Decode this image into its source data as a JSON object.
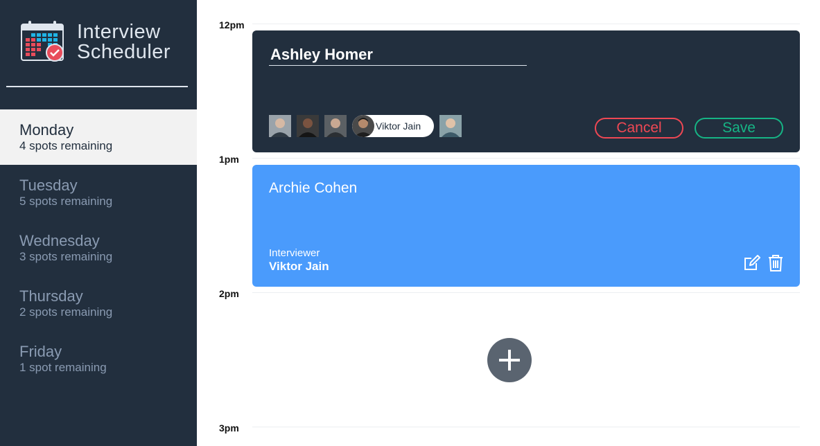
{
  "app": {
    "title_line1": "Interview",
    "title_line2": "Scheduler"
  },
  "sidebar": {
    "days": [
      {
        "name": "Monday",
        "spots": "4 spots remaining",
        "selected": true
      },
      {
        "name": "Tuesday",
        "spots": "5 spots remaining",
        "selected": false
      },
      {
        "name": "Wednesday",
        "spots": "3 spots remaining",
        "selected": false
      },
      {
        "name": "Thursday",
        "spots": "2 spots remaining",
        "selected": false
      },
      {
        "name": "Friday",
        "spots": "1 spot remaining",
        "selected": false
      }
    ]
  },
  "schedule": {
    "times": [
      "12pm",
      "1pm",
      "2pm",
      "3pm"
    ],
    "edit_form": {
      "student_value": "Ashley Homer",
      "interviewers": [
        {
          "name": "",
          "icon": "avatar-1"
        },
        {
          "name": "",
          "icon": "avatar-2"
        },
        {
          "name": "",
          "icon": "avatar-3"
        },
        {
          "name": "Viktor Jain",
          "icon": "avatar-4",
          "selected": true
        },
        {
          "name": "",
          "icon": "avatar-5"
        }
      ],
      "cancel_label": "Cancel",
      "save_label": "Save"
    },
    "appointment": {
      "student": "Archie Cohen",
      "interviewer_label": "Interviewer",
      "interviewer_name": "Viktor Jain"
    }
  },
  "colors": {
    "sidebar_bg": "#222f3e",
    "card_blue": "#4a9bfc",
    "cancel": "#f04854",
    "save": "#16b585"
  }
}
